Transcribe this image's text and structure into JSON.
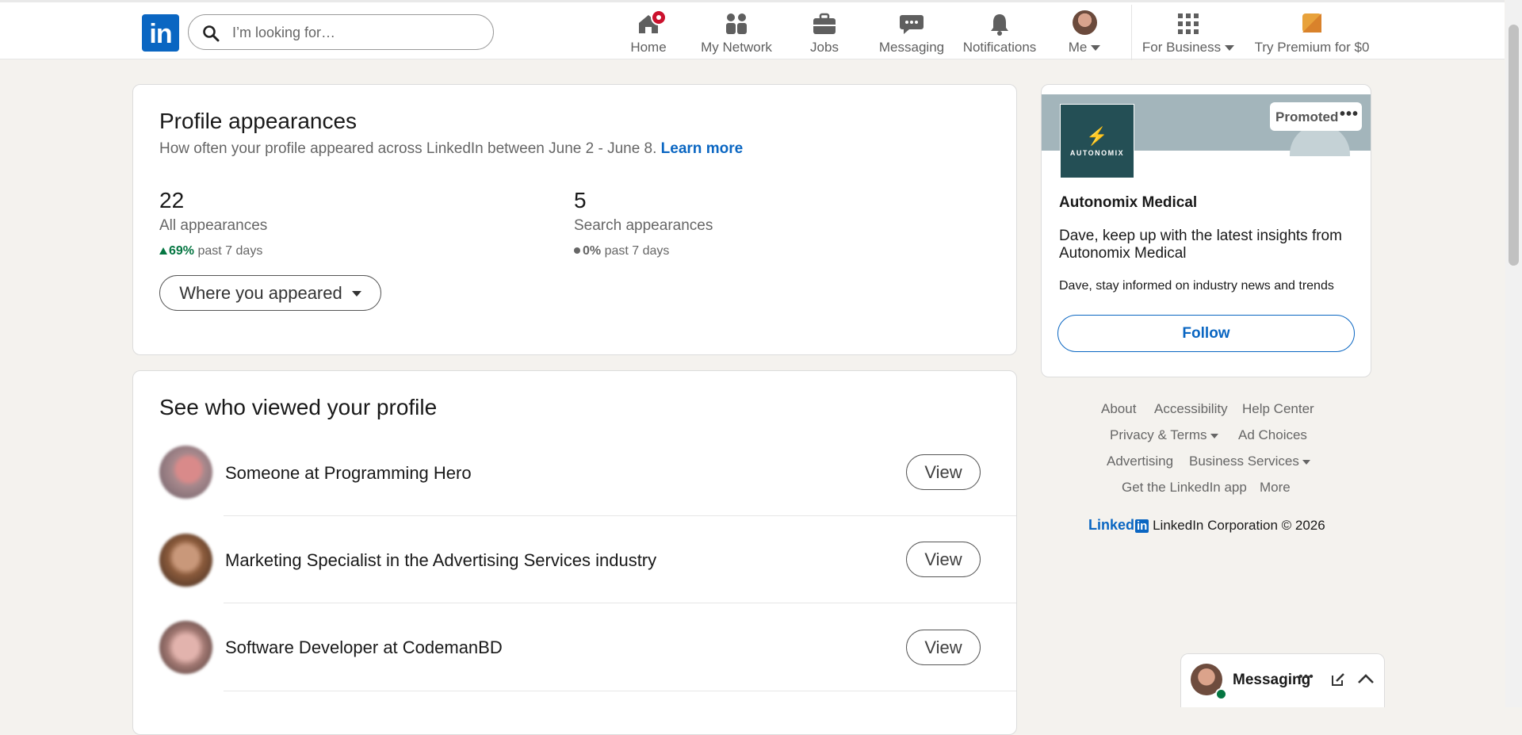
{
  "nav": {
    "logo": "in",
    "search_placeholder": "I’m looking for…",
    "items": [
      {
        "label": "Home",
        "icon": "home-icon",
        "badge": true
      },
      {
        "label": "My Network",
        "icon": "network-icon"
      },
      {
        "label": "Jobs",
        "icon": "briefcase-icon"
      },
      {
        "label": "Messaging",
        "icon": "chat-icon"
      },
      {
        "label": "Notifications",
        "icon": "bell-icon"
      },
      {
        "label": "Me",
        "icon": "avatar"
      },
      {
        "label": "For Business",
        "icon": "grid-icon"
      },
      {
        "label": "Try Premium for $0",
        "icon": "premium-icon"
      }
    ]
  },
  "appearances": {
    "title": "Profile appearances",
    "subtitle": "How often your profile appeared across LinkedIn between June 2 - June 8.",
    "learn_more": "Learn more",
    "all": {
      "value": "22",
      "label": "All appearances",
      "change": "69%",
      "period": "past 7 days"
    },
    "search": {
      "value": "5",
      "label": "Search appearances",
      "change": "0%",
      "period": "past 7 days"
    },
    "where_button": "Where you appeared"
  },
  "viewers": {
    "title": "See who viewed your profile",
    "view_label": "View",
    "rows": [
      {
        "name": "Someone at Programming Hero"
      },
      {
        "name": "Marketing Specialist in the Advertising Services industry"
      },
      {
        "name": "Software Developer at CodemanBD"
      }
    ]
  },
  "ad": {
    "promoted": "Promoted",
    "logo_word": "AUTONOMIX",
    "company": "Autonomix Medical",
    "headline": "Dave, keep up with the latest insights from Autonomix Medical",
    "body": "Dave, stay informed on industry news and trends",
    "follow": "Follow"
  },
  "footer": {
    "about": "About",
    "accessibility": "Accessibility",
    "help": "Help Center",
    "privacy": "Privacy & Terms",
    "adchoices": "Ad Choices",
    "advertising": "Advertising",
    "business": "Business Services",
    "app": "Get the LinkedIn app",
    "more": "More",
    "brand_word": "Linked",
    "copyright": "LinkedIn Corporation © 2026"
  },
  "messaging": {
    "label": "Messaging"
  },
  "colors": {
    "accent": "#0a66c2",
    "positive": "#057642",
    "badge": "#cb112d",
    "background": "#f4f2ee"
  }
}
